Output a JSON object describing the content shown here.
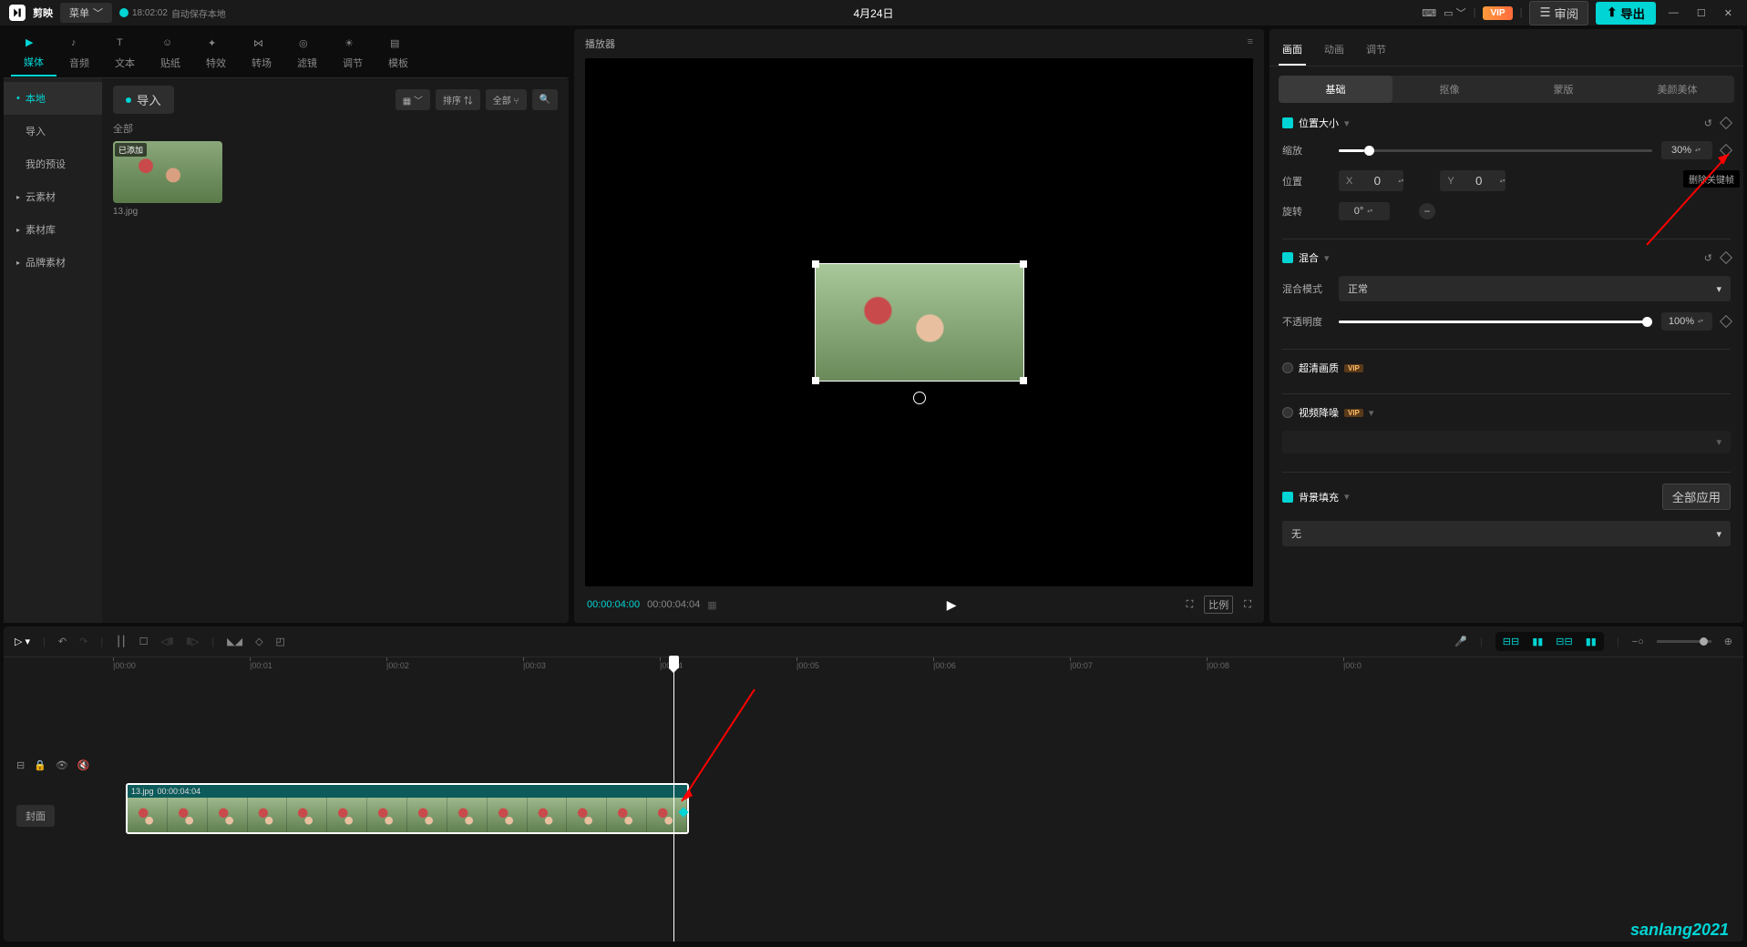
{
  "app": {
    "name": "剪映"
  },
  "titlebar": {
    "menu": "菜单",
    "autosave_time": "18:02:02",
    "autosave_text": "自动保存本地",
    "project": "4月24日",
    "vip": "VIP",
    "review": "审阅",
    "export": "导出"
  },
  "top_tabs": [
    {
      "label": "媒体",
      "active": true
    },
    {
      "label": "音频"
    },
    {
      "label": "文本"
    },
    {
      "label": "贴纸"
    },
    {
      "label": "特效"
    },
    {
      "label": "转场"
    },
    {
      "label": "滤镜"
    },
    {
      "label": "调节"
    },
    {
      "label": "模板"
    }
  ],
  "side_nav": [
    {
      "label": "本地",
      "active": true,
      "chev": true
    },
    {
      "label": "导入",
      "indent": true
    },
    {
      "label": "我的预设",
      "indent": true
    },
    {
      "label": "云素材",
      "chev": true
    },
    {
      "label": "素材库",
      "chev": true
    },
    {
      "label": "品牌素材",
      "chev": true
    }
  ],
  "media": {
    "import": "导入",
    "sort": "排序",
    "all_filter": "全部",
    "list_title": "全部",
    "thumb_badge": "已添加",
    "thumb_name": "13.jpg"
  },
  "player": {
    "title": "播放器",
    "time_current": "00:00:04:00",
    "time_total": "00:00:04:04",
    "ratio": "比例"
  },
  "inspector": {
    "tabs": [
      {
        "label": "画面",
        "active": true
      },
      {
        "label": "动画"
      },
      {
        "label": "调节"
      }
    ],
    "subtabs": [
      {
        "label": "基础",
        "active": true
      },
      {
        "label": "抠像"
      },
      {
        "label": "蒙版"
      },
      {
        "label": "美颜美体"
      }
    ],
    "pos_size": {
      "title": "位置大小",
      "scale_label": "缩放",
      "scale_value": "30%",
      "pos_label": "位置",
      "x": "X",
      "x_val": "0",
      "y": "Y",
      "y_val": "0",
      "rotate_label": "旋转",
      "rotate_val": "0°",
      "tooltip": "删除关键帧"
    },
    "blend": {
      "title": "混合",
      "mode_label": "混合模式",
      "mode_val": "正常",
      "opacity_label": "不透明度",
      "opacity_val": "100%"
    },
    "hd": {
      "title": "超清画质",
      "vip": "VIP"
    },
    "denoise": {
      "title": "视频降噪",
      "vip": "VIP"
    },
    "bg": {
      "title": "背景填充",
      "apply_all": "全部应用",
      "value": "无"
    }
  },
  "timeline": {
    "ruler": [
      "|00:00",
      "|00:01",
      "|00:02",
      "|00:03",
      "|00:04",
      "|00:05",
      "|00:06",
      "|00:07",
      "|00:08",
      "|00:0"
    ],
    "cover": "封面",
    "clip_name": "13.jpg",
    "clip_dur": "00:00:04:04"
  },
  "watermark": "sanlang2021"
}
